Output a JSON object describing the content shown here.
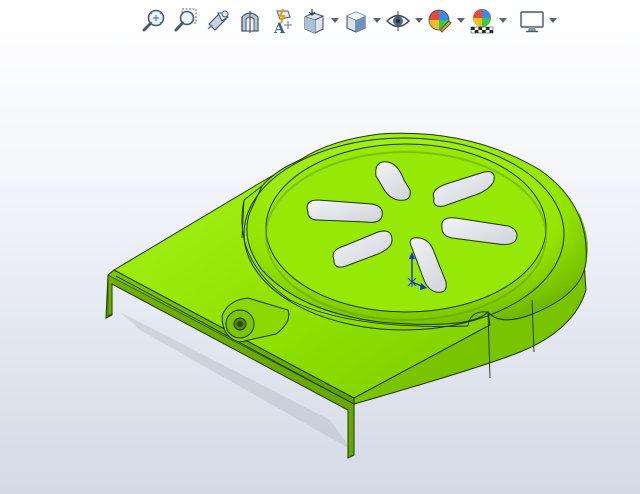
{
  "viewport": {
    "background_top": "#ffffff",
    "background_bottom": "#d4dae6"
  },
  "toolbar": {
    "items": [
      {
        "name": "zoom-to-fit-icon",
        "dropdown": false
      },
      {
        "name": "zoom-to-area-icon",
        "dropdown": false
      },
      {
        "name": "previous-view-icon",
        "dropdown": false
      },
      {
        "name": "section-view-icon",
        "dropdown": false
      },
      {
        "name": "dynamic-annotation-views-icon",
        "dropdown": false
      },
      {
        "name": "view-orientation-icon",
        "dropdown": true
      },
      {
        "name": "display-style-icon",
        "dropdown": true
      },
      {
        "name": "hide-show-items-icon",
        "dropdown": true
      },
      {
        "name": "edit-appearance-icon",
        "dropdown": true
      },
      {
        "name": "apply-scene-icon",
        "dropdown": true
      },
      {
        "name": "view-settings-icon",
        "dropdown": true
      }
    ]
  },
  "model": {
    "color": "#8ee000",
    "shade_color": "#5fa800",
    "highlight_color": "#b4ff3a",
    "edge_color": "#1f3300",
    "slot_interior_color": "#e3e6ea",
    "triad_x_color": "#1a2fd8",
    "triad_y_color": "#1a2fd8"
  }
}
